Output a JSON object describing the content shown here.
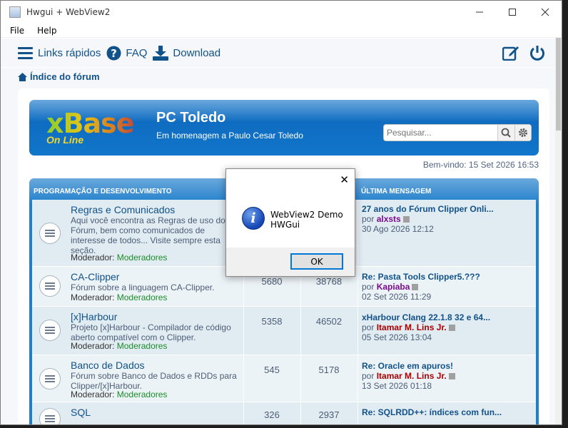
{
  "window": {
    "title": "Hwgui + WebView2"
  },
  "menu": {
    "file": "File",
    "help": "Help"
  },
  "nav": {
    "quick_links": "Links rápidos",
    "faq": "FAQ",
    "download": "Download"
  },
  "breadcrumb": "Índice do fórum",
  "header": {
    "logo_main": "xBase",
    "logo_sub": "On Line",
    "site_title": "PC Toledo",
    "site_desc": "Em homenagem a Paulo Cesar Toledo",
    "search_placeholder": "Pesquisar..."
  },
  "welcome": "Bem-vindo: 15 Set 2026 16:53",
  "forum": {
    "category": "PROGRAMAÇÃO E DESENVOLVIMENTO",
    "last_col": "ÚLTIMA MENSAGEM",
    "rows": [
      {
        "name": "Regras e Comunicados",
        "desc": "Aqui você encontra as Regras de uso do Fórum, bem como comunicados de interesse de todos... Visite sempre esta seção.",
        "mod_label": "Moderador:",
        "mod": "Moderadores",
        "topics": "",
        "posts": "",
        "last_title": "27 anos do Fórum Clipper Onli...",
        "by_label": "por",
        "last_user": "alxsts",
        "last_date": "30 Ago 2026 12:12"
      },
      {
        "name": "CA-Clipper",
        "desc": "Fórum sobre a linguagem CA-Clipper.",
        "mod_label": "Moderador:",
        "mod": "Moderadores",
        "topics": "5680",
        "posts": "38768",
        "last_title": "Re: Pasta Tools Clipper5.???",
        "by_label": "por",
        "last_user": "Kapiaba",
        "last_date": "02 Set 2026 11:29"
      },
      {
        "name": "[x]Harbour",
        "desc": "Projeto [x]Harbour - Compilador de código aberto compatível com o Clipper.",
        "mod_label": "Moderador:",
        "mod": "Moderadores",
        "topics": "5358",
        "posts": "46502",
        "last_title": "xHarbour Clang 22.1.8 32 e 64...",
        "by_label": "por",
        "last_user": "Itamar M. Lins Jr.",
        "last_date": "05 Set 2026 13:04"
      },
      {
        "name": "Banco de Dados",
        "desc": "Fórum sobre Banco de Dados e RDDs para Clipper/[x]Harbour.",
        "mod_label": "Moderador:",
        "mod": "Moderadores",
        "topics": "545",
        "posts": "5178",
        "last_title": "Re: Oracle em apuros!",
        "by_label": "por",
        "last_user": "Itamar M. Lins Jr.",
        "last_date": "13 Set 2026 01:18"
      },
      {
        "name": "SQL",
        "desc": "",
        "mod_label": "",
        "mod": "",
        "topics": "326",
        "posts": "2937",
        "last_title": "Re: SQLRDD++: índices com fun...",
        "by_label": "",
        "last_user": "",
        "last_date": ""
      }
    ]
  },
  "dialog": {
    "line1": "WebView2 Demo",
    "line2": "HWGui",
    "ok": "OK",
    "close": "✕"
  },
  "colors": {
    "accent": "#105289",
    "header_blue": "#1176c9",
    "moderator": "#1c8c2a",
    "user_red": "#aa0000",
    "user_purple": "#7a0a8b"
  }
}
